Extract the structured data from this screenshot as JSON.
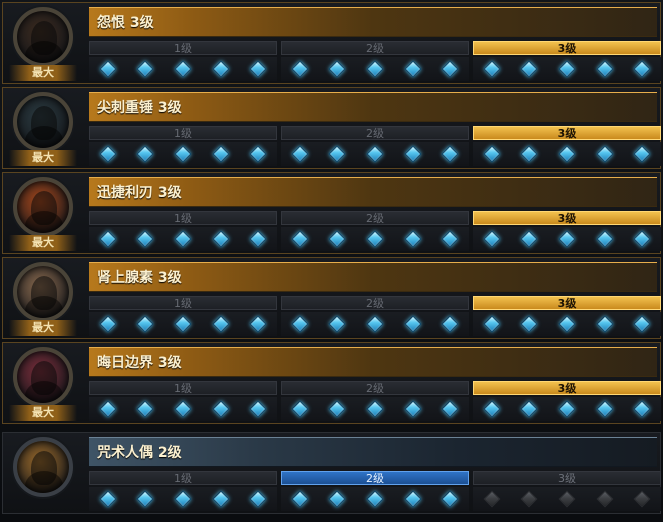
{
  "rows": [
    {
      "title": "怨恨 3级",
      "badge": "最大",
      "tiers": [
        "1级",
        "2级",
        "3级"
      ],
      "portrait_color": "#3b2a1e",
      "gems_on": [
        5,
        5,
        5
      ]
    },
    {
      "title": "尖刺重锤 3级",
      "badge": "最大",
      "tiers": [
        "1级",
        "2级",
        "3级"
      ],
      "portrait_color": "#2a3a40",
      "gems_on": [
        5,
        5,
        5
      ]
    },
    {
      "title": "迅捷利刃 3级",
      "badge": "最大",
      "tiers": [
        "1级",
        "2级",
        "3级"
      ],
      "portrait_color": "#a7471b",
      "gems_on": [
        5,
        5,
        5
      ]
    },
    {
      "title": "肾上腺素 3级",
      "badge": "最大",
      "tiers": [
        "1级",
        "2级",
        "3级"
      ],
      "portrait_color": "#8a6a4e",
      "gems_on": [
        5,
        5,
        5
      ]
    },
    {
      "title": "晦日边界 3级",
      "badge": "最大",
      "tiers": [
        "1级",
        "2级",
        "3级"
      ],
      "portrait_color": "#7a2d3a",
      "gems_on": [
        5,
        5,
        5
      ]
    },
    {
      "title": "咒术人偶 2级",
      "badge": "",
      "tiers": [
        "1级",
        "2级",
        "3级"
      ],
      "portrait_color": "#9b6a2a",
      "gems_on": [
        5,
        5,
        0
      ]
    }
  ],
  "colors": {
    "gold_accent": "#f2c14e",
    "blue_accent": "#2f73c7",
    "gem_blue": "#56c6ef"
  }
}
